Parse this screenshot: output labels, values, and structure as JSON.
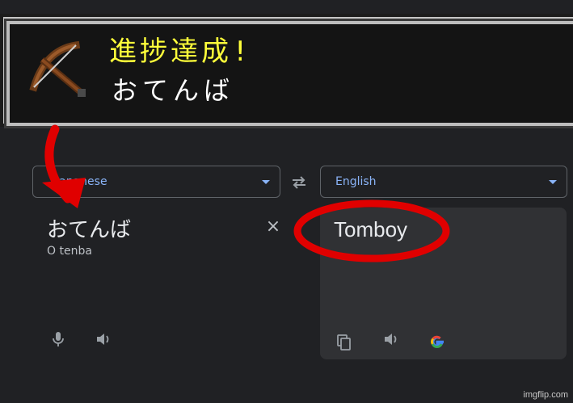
{
  "advancement": {
    "title": "進捗達成!",
    "subtitle": "おてんば",
    "icon": "crossbow-icon"
  },
  "translate": {
    "source_language": "Japanese",
    "source_language_visible": "ese",
    "target_language": "English",
    "source_text": "おてんば",
    "source_romanization": "O tenba",
    "target_text": "Tomboy",
    "clear_label": "×"
  },
  "annotations": {
    "arrow_color": "#e00000",
    "circle_color": "#e00000"
  },
  "watermark": "imgflip.com",
  "colors": {
    "background": "#202124",
    "accent": "#8ab4f8",
    "toast_title": "#ffff3a"
  }
}
